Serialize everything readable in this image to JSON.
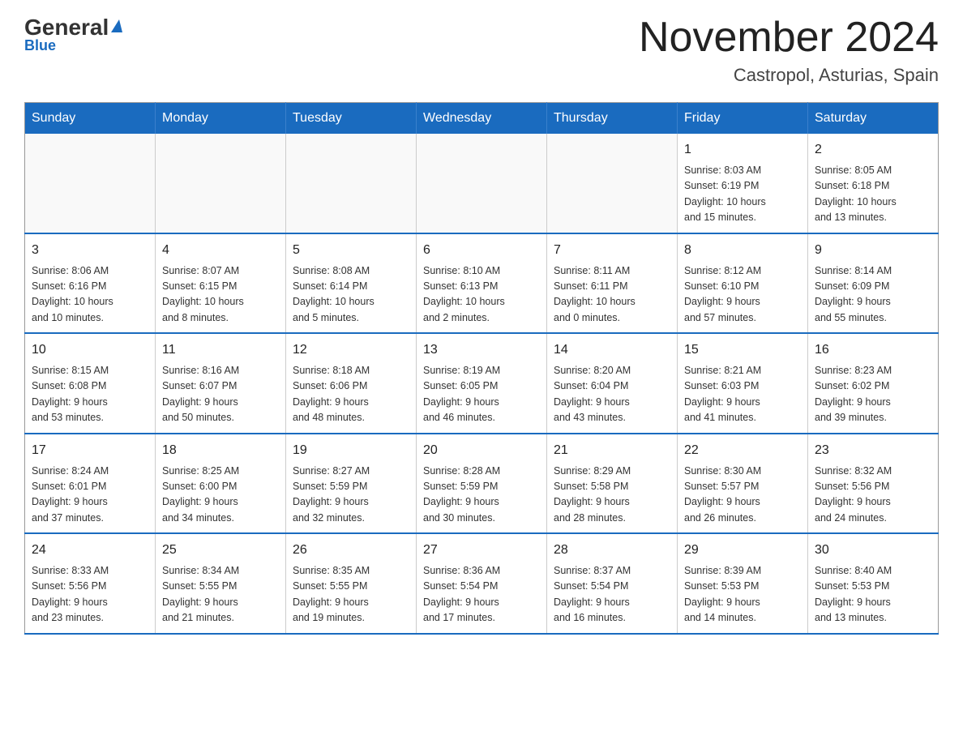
{
  "header": {
    "logo_general": "General",
    "logo_blue": "Blue",
    "month_title": "November 2024",
    "location": "Castropol, Asturias, Spain"
  },
  "days_of_week": [
    "Sunday",
    "Monday",
    "Tuesday",
    "Wednesday",
    "Thursday",
    "Friday",
    "Saturday"
  ],
  "weeks": [
    [
      {
        "day": "",
        "info": ""
      },
      {
        "day": "",
        "info": ""
      },
      {
        "day": "",
        "info": ""
      },
      {
        "day": "",
        "info": ""
      },
      {
        "day": "",
        "info": ""
      },
      {
        "day": "1",
        "info": "Sunrise: 8:03 AM\nSunset: 6:19 PM\nDaylight: 10 hours\nand 15 minutes."
      },
      {
        "day": "2",
        "info": "Sunrise: 8:05 AM\nSunset: 6:18 PM\nDaylight: 10 hours\nand 13 minutes."
      }
    ],
    [
      {
        "day": "3",
        "info": "Sunrise: 8:06 AM\nSunset: 6:16 PM\nDaylight: 10 hours\nand 10 minutes."
      },
      {
        "day": "4",
        "info": "Sunrise: 8:07 AM\nSunset: 6:15 PM\nDaylight: 10 hours\nand 8 minutes."
      },
      {
        "day": "5",
        "info": "Sunrise: 8:08 AM\nSunset: 6:14 PM\nDaylight: 10 hours\nand 5 minutes."
      },
      {
        "day": "6",
        "info": "Sunrise: 8:10 AM\nSunset: 6:13 PM\nDaylight: 10 hours\nand 2 minutes."
      },
      {
        "day": "7",
        "info": "Sunrise: 8:11 AM\nSunset: 6:11 PM\nDaylight: 10 hours\nand 0 minutes."
      },
      {
        "day": "8",
        "info": "Sunrise: 8:12 AM\nSunset: 6:10 PM\nDaylight: 9 hours\nand 57 minutes."
      },
      {
        "day": "9",
        "info": "Sunrise: 8:14 AM\nSunset: 6:09 PM\nDaylight: 9 hours\nand 55 minutes."
      }
    ],
    [
      {
        "day": "10",
        "info": "Sunrise: 8:15 AM\nSunset: 6:08 PM\nDaylight: 9 hours\nand 53 minutes."
      },
      {
        "day": "11",
        "info": "Sunrise: 8:16 AM\nSunset: 6:07 PM\nDaylight: 9 hours\nand 50 minutes."
      },
      {
        "day": "12",
        "info": "Sunrise: 8:18 AM\nSunset: 6:06 PM\nDaylight: 9 hours\nand 48 minutes."
      },
      {
        "day": "13",
        "info": "Sunrise: 8:19 AM\nSunset: 6:05 PM\nDaylight: 9 hours\nand 46 minutes."
      },
      {
        "day": "14",
        "info": "Sunrise: 8:20 AM\nSunset: 6:04 PM\nDaylight: 9 hours\nand 43 minutes."
      },
      {
        "day": "15",
        "info": "Sunrise: 8:21 AM\nSunset: 6:03 PM\nDaylight: 9 hours\nand 41 minutes."
      },
      {
        "day": "16",
        "info": "Sunrise: 8:23 AM\nSunset: 6:02 PM\nDaylight: 9 hours\nand 39 minutes."
      }
    ],
    [
      {
        "day": "17",
        "info": "Sunrise: 8:24 AM\nSunset: 6:01 PM\nDaylight: 9 hours\nand 37 minutes."
      },
      {
        "day": "18",
        "info": "Sunrise: 8:25 AM\nSunset: 6:00 PM\nDaylight: 9 hours\nand 34 minutes."
      },
      {
        "day": "19",
        "info": "Sunrise: 8:27 AM\nSunset: 5:59 PM\nDaylight: 9 hours\nand 32 minutes."
      },
      {
        "day": "20",
        "info": "Sunrise: 8:28 AM\nSunset: 5:59 PM\nDaylight: 9 hours\nand 30 minutes."
      },
      {
        "day": "21",
        "info": "Sunrise: 8:29 AM\nSunset: 5:58 PM\nDaylight: 9 hours\nand 28 minutes."
      },
      {
        "day": "22",
        "info": "Sunrise: 8:30 AM\nSunset: 5:57 PM\nDaylight: 9 hours\nand 26 minutes."
      },
      {
        "day": "23",
        "info": "Sunrise: 8:32 AM\nSunset: 5:56 PM\nDaylight: 9 hours\nand 24 minutes."
      }
    ],
    [
      {
        "day": "24",
        "info": "Sunrise: 8:33 AM\nSunset: 5:56 PM\nDaylight: 9 hours\nand 23 minutes."
      },
      {
        "day": "25",
        "info": "Sunrise: 8:34 AM\nSunset: 5:55 PM\nDaylight: 9 hours\nand 21 minutes."
      },
      {
        "day": "26",
        "info": "Sunrise: 8:35 AM\nSunset: 5:55 PM\nDaylight: 9 hours\nand 19 minutes."
      },
      {
        "day": "27",
        "info": "Sunrise: 8:36 AM\nSunset: 5:54 PM\nDaylight: 9 hours\nand 17 minutes."
      },
      {
        "day": "28",
        "info": "Sunrise: 8:37 AM\nSunset: 5:54 PM\nDaylight: 9 hours\nand 16 minutes."
      },
      {
        "day": "29",
        "info": "Sunrise: 8:39 AM\nSunset: 5:53 PM\nDaylight: 9 hours\nand 14 minutes."
      },
      {
        "day": "30",
        "info": "Sunrise: 8:40 AM\nSunset: 5:53 PM\nDaylight: 9 hours\nand 13 minutes."
      }
    ]
  ]
}
